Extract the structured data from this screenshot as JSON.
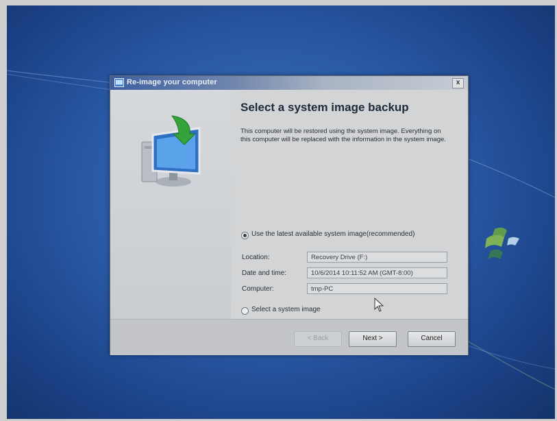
{
  "dialog": {
    "title": "Re-image your computer",
    "close_symbol": "x",
    "heading": "Select a system image backup",
    "description": "This computer will be restored using the system image. Everything on this computer will be replaced with the information in the system image.",
    "option_latest": {
      "label": "Use the latest available system image(recommended)",
      "checked": true
    },
    "fields": {
      "location": {
        "label": "Location:",
        "value": "Recovery Drive (F:)"
      },
      "datetime": {
        "label": "Date and time:",
        "value": "10/6/2014 10:11:52 AM (GMT-8:00)"
      },
      "computer": {
        "label": "Computer:",
        "value": "tmp-PC"
      }
    },
    "option_select": {
      "label": "Select a system image",
      "checked": false
    },
    "buttons": {
      "back": "< Back",
      "next": "Next >",
      "cancel": "Cancel"
    }
  },
  "icons": [
    "window-icon",
    "close-icon",
    "restore-illustration-icon",
    "mouse-cursor-icon",
    "windows-logo-icon"
  ],
  "colors": {
    "desktop": "#2a5aa6",
    "dialog_bg": "#d3d4d5",
    "title_bar": "#3d5fa0"
  }
}
